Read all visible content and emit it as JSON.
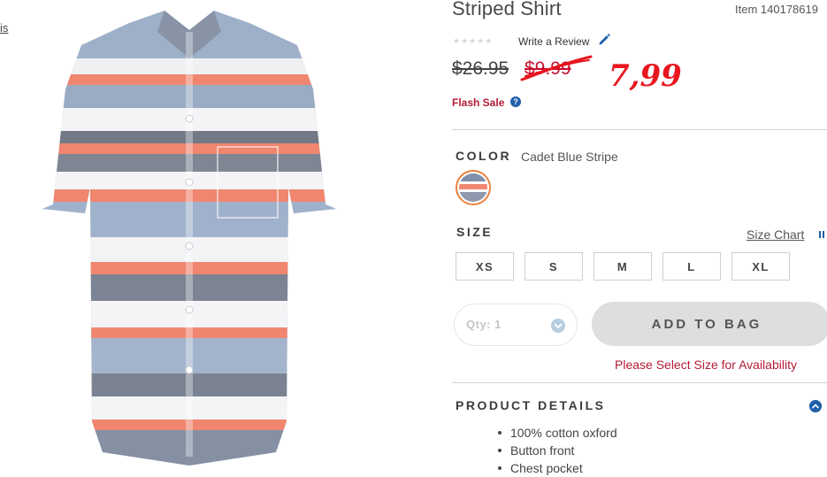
{
  "nav": {
    "edge_link": "is"
  },
  "product": {
    "title": "Striped Shirt",
    "item_number": "Item 140178619",
    "write_review": "Write a Review",
    "rating_stars": 0,
    "price_was": "$26.95",
    "price_sale": "$9.99",
    "handwritten_price": "7,99",
    "flash_sale": "Flash Sale",
    "help_icon": "?"
  },
  "color": {
    "label": "COLOR",
    "selected": "Cadet Blue Stripe",
    "swatch_colors": [
      "#7f90ab",
      "#ffffff",
      "#f0866f",
      "#8f99ad"
    ]
  },
  "size": {
    "label": "SIZE",
    "size_chart_link": "Size Chart",
    "options": [
      "XS",
      "S",
      "M",
      "L",
      "XL"
    ]
  },
  "purchase": {
    "qty_label": "Qty: 1",
    "add_to_bag": "ADD TO BAG",
    "select_size_msg": "Please Select Size for Availability"
  },
  "details": {
    "label": "PRODUCT DETAILS",
    "bullets": [
      "100% cotton oxford",
      "Button front",
      "Chest pocket"
    ]
  },
  "colors": {
    "sale_red": "#c8102e",
    "flash_red": "#b31b34",
    "handwritten_red": "#e8161e",
    "accent_blue": "#1f5fa8",
    "button_gray": "#dedede",
    "swatch_ring": "#e9823f"
  },
  "icons": [
    "pencil-icon",
    "help-icon",
    "ruler-icon",
    "chevron-down-icon",
    "collapse-icon"
  ]
}
